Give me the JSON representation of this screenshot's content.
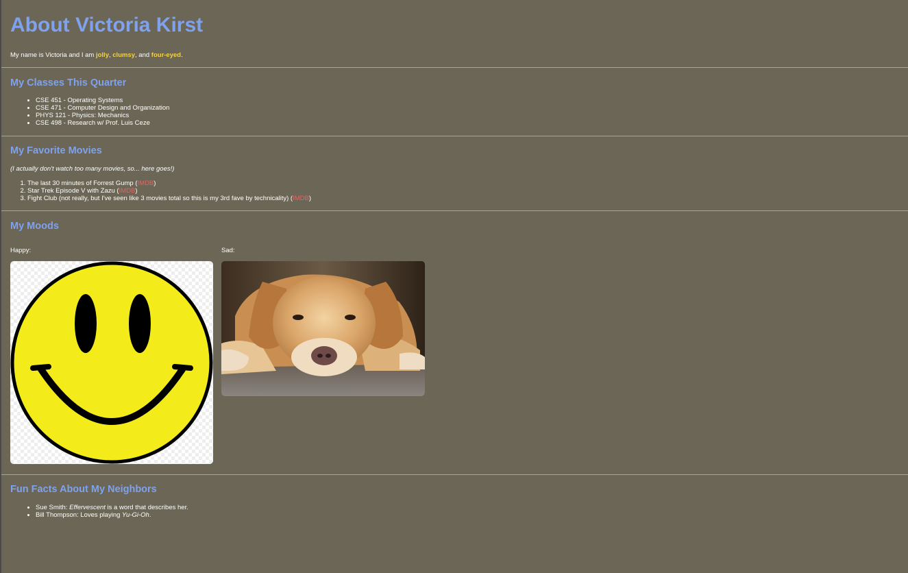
{
  "page": {
    "title": "About Victoria Kirst",
    "intro": {
      "prefix": "My name is Victoria and I am ",
      "adjectives": [
        "jolly",
        "clumsy",
        "four-eyed"
      ],
      "sep1": ", ",
      "sep2": ", and ",
      "end": "."
    }
  },
  "classes": {
    "heading": "My Classes This Quarter",
    "items": [
      "CSE 451 - Operating Systems",
      "CSE 471 - Computer Design and Organization",
      "PHYS 121 - Physics: Mechanics",
      "CSE 498 - Research w/ Prof. Luis Ceze"
    ]
  },
  "movies": {
    "heading": "My Favorite Movies",
    "note": "(I actually don't watch too many movies, so... here goes!)",
    "items": [
      {
        "text": "The last 30 minutes of Forrest Gump",
        "link": "IMDB"
      },
      {
        "text": "Star Trek Episode V with Zazu",
        "link": "IMDB"
      },
      {
        "text": "Fight Club (not really, but I've seen like 3 movies total so this is my 3rd fave by technicality)",
        "link": "IMDB"
      }
    ]
  },
  "moods": {
    "heading": "My Moods",
    "happy_label": "Happy:",
    "sad_label": "Sad:",
    "happy_image": "smiley-face-image",
    "sad_image": "sad-golden-retriever-image"
  },
  "neighbors": {
    "heading": "Fun Facts About My Neighbors",
    "items": [
      {
        "name": "Sue Smith: ",
        "emph": "Effervescent",
        "rest": " is a word that describes her."
      },
      {
        "name": "Bill Thompson: Loves playing ",
        "emph": "Yu-Gi-Oh",
        "rest": "."
      }
    ]
  },
  "colors": {
    "background": "#6b6655",
    "heading": "#7fa2ee",
    "adjective": "#f2d24a",
    "link": "#e06666"
  }
}
